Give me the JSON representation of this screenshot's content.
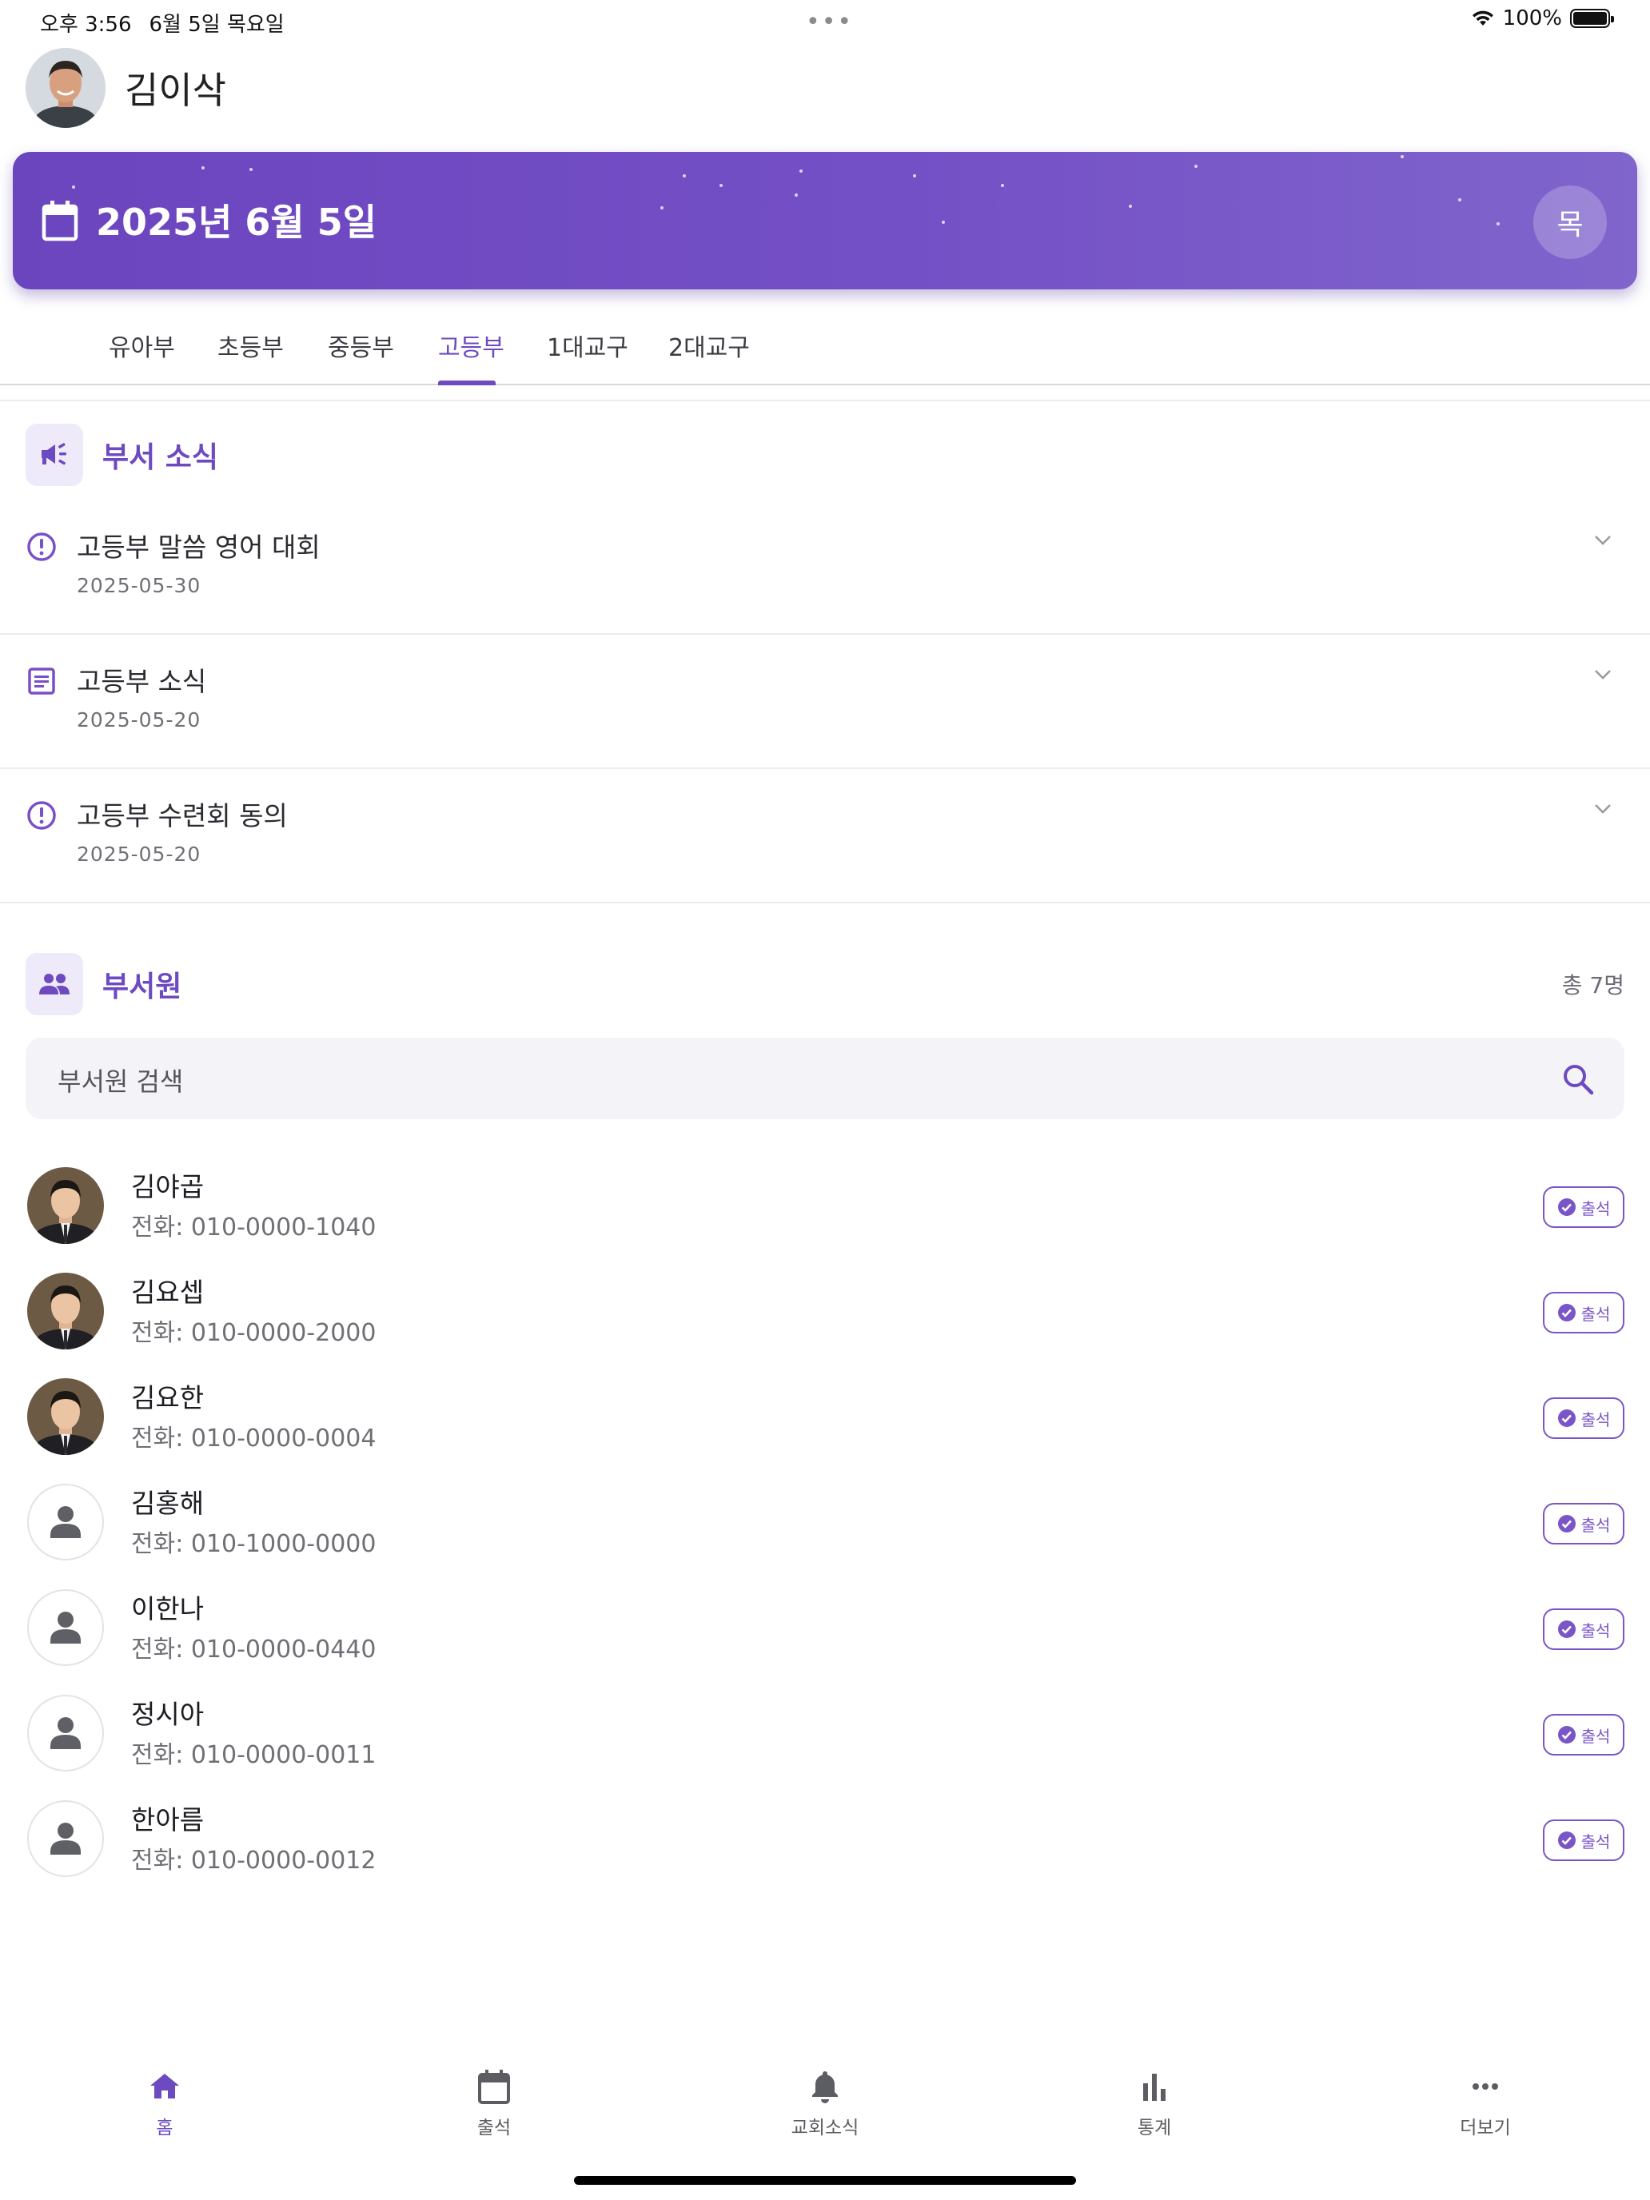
{
  "status_bar": {
    "time": "오후 3:56",
    "date": "6월 5일 목요일",
    "battery": "100%",
    "battery_level": 1.0
  },
  "user": {
    "name": "김이삭"
  },
  "banner": {
    "date": "2025년 6월 5일",
    "weekday": "목",
    "color": "#7450c6"
  },
  "tabs": [
    {
      "label": "유아부",
      "active": false
    },
    {
      "label": "초등부",
      "active": false
    },
    {
      "label": "중등부",
      "active": false
    },
    {
      "label": "고등부",
      "active": true
    },
    {
      "label": "1대교구",
      "active": false
    },
    {
      "label": "2대교구",
      "active": false
    }
  ],
  "news_section": {
    "title": "부서 소식",
    "icon": "megaphone-icon",
    "items": [
      {
        "title": "고등부 말씀 영어 대회",
        "date": "2025-05-30",
        "icon": "alert-circle-icon"
      },
      {
        "title": "고등부 소식",
        "date": "2025-05-20",
        "icon": "document-icon"
      },
      {
        "title": "고등부 수련회 동의",
        "date": "2025-05-20",
        "icon": "alert-circle-icon"
      }
    ]
  },
  "members_section": {
    "title": "부서원",
    "icon": "people-icon",
    "count": "총 7명",
    "search_placeholder": "부서원 검색",
    "members": [
      {
        "name": "김야곱",
        "phone": "전화: 010-0000-1040",
        "status": "출석",
        "has_photo": true
      },
      {
        "name": "김요셉",
        "phone": "전화: 010-0000-2000",
        "status": "출석",
        "has_photo": true
      },
      {
        "name": "김요한",
        "phone": "전화: 010-0000-0004",
        "status": "출석",
        "has_photo": true
      },
      {
        "name": "김홍해",
        "phone": "전화: 010-1000-0000",
        "status": "출석",
        "has_photo": false
      },
      {
        "name": "이한나",
        "phone": "전화: 010-0000-0440",
        "status": "출석",
        "has_photo": false
      },
      {
        "name": "정시아",
        "phone": "전화: 010-0000-0011",
        "status": "출석",
        "has_photo": false
      },
      {
        "name": "한아름",
        "phone": "전화: 010-0000-0012",
        "status": "출석",
        "has_photo": false
      }
    ]
  },
  "bottom_nav": [
    {
      "label": "홈",
      "icon": "home-icon",
      "active": true
    },
    {
      "label": "출석",
      "icon": "calendar-icon",
      "active": false
    },
    {
      "label": "교회소식",
      "icon": "bell-icon",
      "active": false
    },
    {
      "label": "통계",
      "icon": "bar-chart-icon",
      "active": false
    },
    {
      "label": "더보기",
      "icon": "more-icon",
      "active": false
    }
  ],
  "colors": {
    "accent": "#6e4ac0",
    "accent_light": "#efeaf9"
  }
}
